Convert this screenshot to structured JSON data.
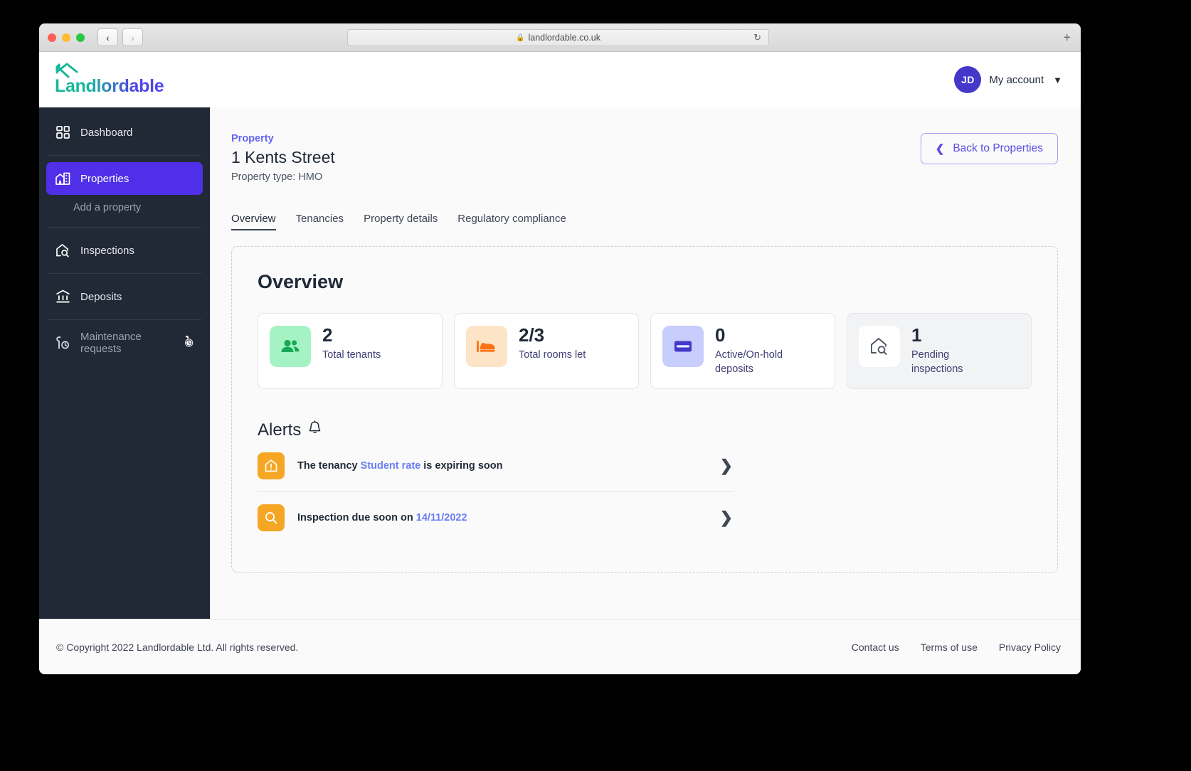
{
  "browser": {
    "url": "landlordable.co.uk",
    "lock_icon": "lock-icon",
    "back_icon": "chevron-left-icon",
    "forward_icon": "chevron-right-icon",
    "reload_icon": "reload-icon",
    "new_tab_icon": "plus-icon"
  },
  "header": {
    "logo_text": "Landlordable",
    "account_initials": "JD",
    "account_label": "My account",
    "caret_icon": "chevron-down-icon"
  },
  "sidebar": {
    "items": [
      {
        "label": "Dashboard",
        "icon": "dashboard-grid-icon",
        "active": false
      },
      {
        "label": "Properties",
        "icon": "building-home-icon",
        "active": true
      },
      {
        "label": "Add a property",
        "icon": "",
        "active": false
      },
      {
        "label": "Inspections",
        "icon": "home-search-icon",
        "active": false
      },
      {
        "label": "Deposits",
        "icon": "bank-icon",
        "active": false
      },
      {
        "label": "Maintenance requests",
        "icon": "wrench-clock-icon",
        "active": false
      }
    ],
    "maintenance_badge_icon": "clock-badge-icon"
  },
  "page": {
    "eyebrow": "Property",
    "title": "1 Kents Street",
    "subtitle": "Property type: HMO",
    "back_button": "Back to Properties",
    "back_icon": "chevron-left-icon"
  },
  "tabs": [
    {
      "label": "Overview",
      "active": true
    },
    {
      "label": "Tenancies",
      "active": false
    },
    {
      "label": "Property details",
      "active": false
    },
    {
      "label": "Regulatory compliance",
      "active": false
    }
  ],
  "overview": {
    "title": "Overview",
    "stats": [
      {
        "value": "2",
        "label": "Total tenants",
        "icon": "people-icon",
        "icon_bg": "#a5f3c4",
        "icon_color": "#17a855",
        "card_bg": "#ffffff"
      },
      {
        "value": "2/3",
        "label": "Total rooms let",
        "icon": "bed-icon",
        "icon_bg": "#fde4c6",
        "icon_color": "#f97316",
        "card_bg": "#ffffff"
      },
      {
        "value": "0",
        "label": "Active/On-hold deposits",
        "icon": "card-icon",
        "icon_bg": "#c7cdfc",
        "icon_color": "#4338ca",
        "card_bg": "#ffffff"
      },
      {
        "value": "1",
        "label": "Pending inspections",
        "icon": "home-search-icon",
        "icon_bg": "#ffffff",
        "icon_color": "#4b5563",
        "card_bg": "#f2f3f5"
      }
    ]
  },
  "alerts": {
    "title": "Alerts",
    "bell_icon": "bell-icon",
    "items": [
      {
        "prefix": "The tenancy ",
        "link": "Student rate",
        "suffix": " is expiring soon",
        "icon": "home-alert-icon",
        "chevron_icon": "chevron-right-icon"
      },
      {
        "prefix": "Inspection due soon on ",
        "link": "14/11/2022",
        "suffix": "",
        "icon": "search-icon",
        "chevron_icon": "chevron-right-icon"
      }
    ]
  },
  "footer": {
    "copyright": "© Copyright 2022 Landlordable Ltd. All rights reserved.",
    "links": [
      "Contact us",
      "Terms of use",
      "Privacy Policy"
    ]
  },
  "colors": {
    "accent": "#4f2fe8",
    "sidebar_bg": "#212936",
    "alert_orange": "#f5a623",
    "link_blue": "#6a7df5",
    "logo_teal": "#16b79c"
  }
}
